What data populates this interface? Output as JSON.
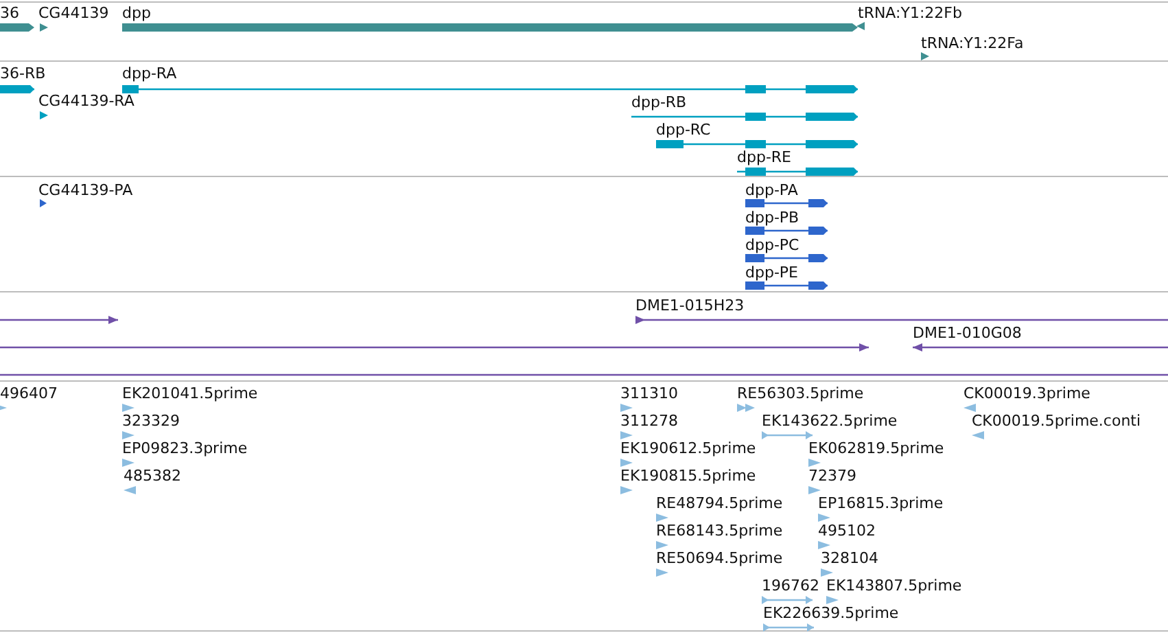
{
  "tracks": [
    {
      "kind": "gene",
      "features": [
        {
          "label": "36",
          "reverse": false
        },
        {
          "label": "CG44139",
          "reverse": false
        },
        {
          "label": "dpp",
          "reverse": false
        },
        {
          "label": "tRNA:Y1:22Fb",
          "reverse": true
        },
        {
          "label": "tRNA:Y1:22Fa",
          "reverse": false
        }
      ]
    },
    {
      "kind": "transcript",
      "features": [
        {
          "label": "36-RB",
          "reverse": false
        },
        {
          "label": "dpp-RA",
          "reverse": false
        },
        {
          "label": "CG44139-RA",
          "reverse": false
        },
        {
          "label": "dpp-RB",
          "reverse": false
        },
        {
          "label": "dpp-RC",
          "reverse": false
        },
        {
          "label": "dpp-RE",
          "reverse": false
        }
      ]
    },
    {
      "kind": "protein",
      "features": [
        {
          "label": "CG44139-PA",
          "reverse": false
        },
        {
          "label": "dpp-PA",
          "reverse": false
        },
        {
          "label": "dpp-PB",
          "reverse": false
        },
        {
          "label": "dpp-PC",
          "reverse": false
        },
        {
          "label": "dpp-PE",
          "reverse": false
        }
      ]
    },
    {
      "kind": "clone",
      "features": [
        {
          "reverse": false
        },
        {
          "label": "DME1-015H23",
          "reverse": false
        },
        {
          "reverse": false
        },
        {
          "label": "DME1-010G08",
          "reverse": true
        }
      ]
    },
    {
      "kind": "est",
      "features": [
        {
          "label": "496407",
          "reverse": false
        },
        {
          "label": "EK201041.5prime",
          "reverse": false
        },
        {
          "label": "323329",
          "reverse": false
        },
        {
          "label": "EP09823.3prime",
          "reverse": false
        },
        {
          "label": "485382",
          "reverse": true
        },
        {
          "label": "311310",
          "reverse": false
        },
        {
          "label": "311278",
          "reverse": false
        },
        {
          "label": "EK190612.5prime",
          "reverse": false
        },
        {
          "label": "EK190815.5prime",
          "reverse": false
        },
        {
          "label": "RE48794.5prime",
          "reverse": false
        },
        {
          "label": "RE68143.5prime",
          "reverse": false
        },
        {
          "label": "RE50694.5prime",
          "reverse": false
        },
        {
          "label": "RE56303.5prime",
          "reverse": false
        },
        {
          "label": "EK143622.5prime",
          "reverse": false
        },
        {
          "label": "EK062819.5prime",
          "reverse": false
        },
        {
          "label": "72379",
          "reverse": false
        },
        {
          "label": "EP16815.3prime",
          "reverse": false
        },
        {
          "label": "495102",
          "reverse": false
        },
        {
          "label": "328104",
          "reverse": false
        },
        {
          "label": "196762",
          "reverse": false
        },
        {
          "label": "EK143807.5prime",
          "reverse": false
        },
        {
          "label": "EK226639.5prime",
          "reverse": false
        },
        {
          "label": "CK00019.3prime",
          "reverse": true
        },
        {
          "label": "CK00019.5prime.conti",
          "reverse": true
        }
      ]
    }
  ]
}
